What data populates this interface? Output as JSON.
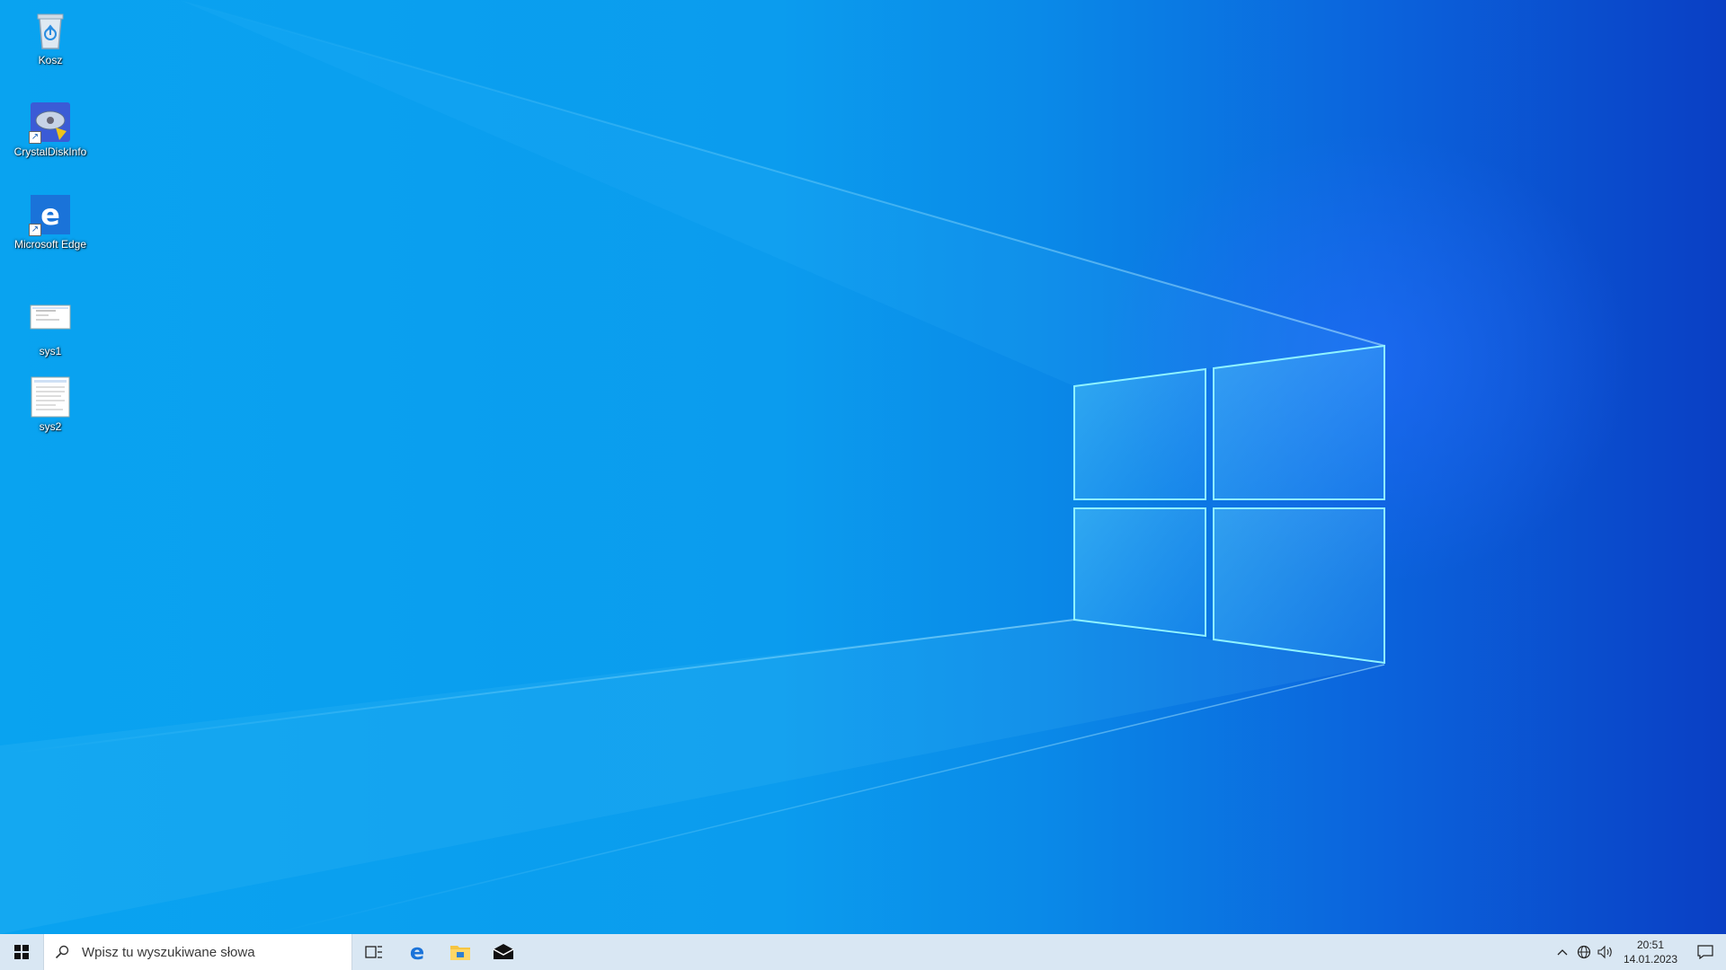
{
  "desktop": {
    "icons": [
      {
        "name": "recycle-bin",
        "label": "Kosz"
      },
      {
        "name": "crystaldiskinfo",
        "label": "CrystalDiskInfo"
      },
      {
        "name": "microsoft-edge",
        "label": "Microsoft Edge"
      },
      {
        "name": "sys1",
        "label": "sys1"
      },
      {
        "name": "sys2",
        "label": "sys2"
      }
    ]
  },
  "taskbar": {
    "search_placeholder": "Wpisz tu wyszukiwane słowa",
    "pinned": [
      "task-view-icon",
      "edge-icon",
      "file-explorer-icon",
      "mail-icon"
    ],
    "clock": {
      "time": "20:51",
      "date": "14.01.2023"
    },
    "tray": [
      "chevron-up-icon",
      "network-globe-icon",
      "volume-icon"
    ]
  },
  "colors": {
    "taskbar_bg": "#d9e7f3",
    "wallpaper_light": "#09a3f0",
    "wallpaper_dark": "#0a3fc4"
  }
}
